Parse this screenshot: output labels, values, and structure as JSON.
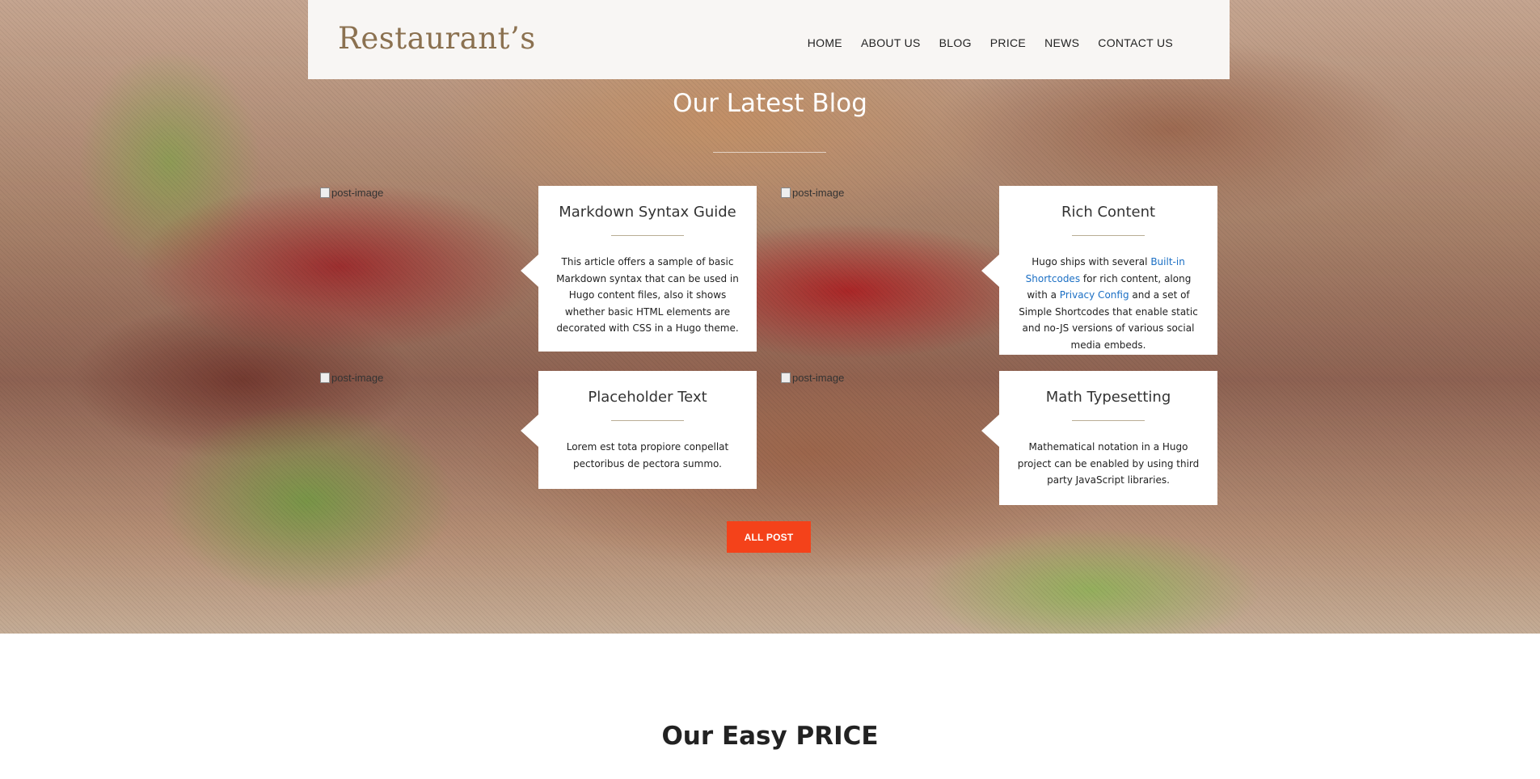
{
  "brand": {
    "logo": "Restaurant’s"
  },
  "nav": {
    "items": [
      {
        "label": "HOME"
      },
      {
        "label": "ABOUT US"
      },
      {
        "label": "BLOG"
      },
      {
        "label": "PRICE"
      },
      {
        "label": "NEWS"
      },
      {
        "label": "CONTACT US"
      }
    ]
  },
  "blog": {
    "title": "Our Latest Blog",
    "image_alt": "post-image",
    "posts": [
      {
        "title": "Markdown Syntax Guide",
        "text": "This article offers a sample of basic Markdown syntax that can be used in Hugo content files, also it shows whether basic HTML elements are decorated with CSS in a Hugo theme."
      },
      {
        "title": "Rich Content",
        "text_1": "Hugo ships with several ",
        "link_1": "Built-in Shortcodes",
        "text_2": " for rich content, along with a ",
        "link_2": "Privacy Config",
        "text_3": " and a set of Simple Shortcodes that enable static and no-JS versions of various social media embeds."
      },
      {
        "title": "Placeholder Text",
        "text": "Lorem est tota propiore conpellat pectoribus de pectora summo."
      },
      {
        "title": "Math Typesetting",
        "text": "Mathematical notation in a Hugo project can be enabled by using third party JavaScript libraries."
      }
    ],
    "all_post_label": "ALL POST"
  },
  "price": {
    "title": "Our Easy PRICE"
  },
  "colors": {
    "accent": "#f4421a",
    "logo": "#8b7150",
    "link": "#1b6fc4"
  }
}
